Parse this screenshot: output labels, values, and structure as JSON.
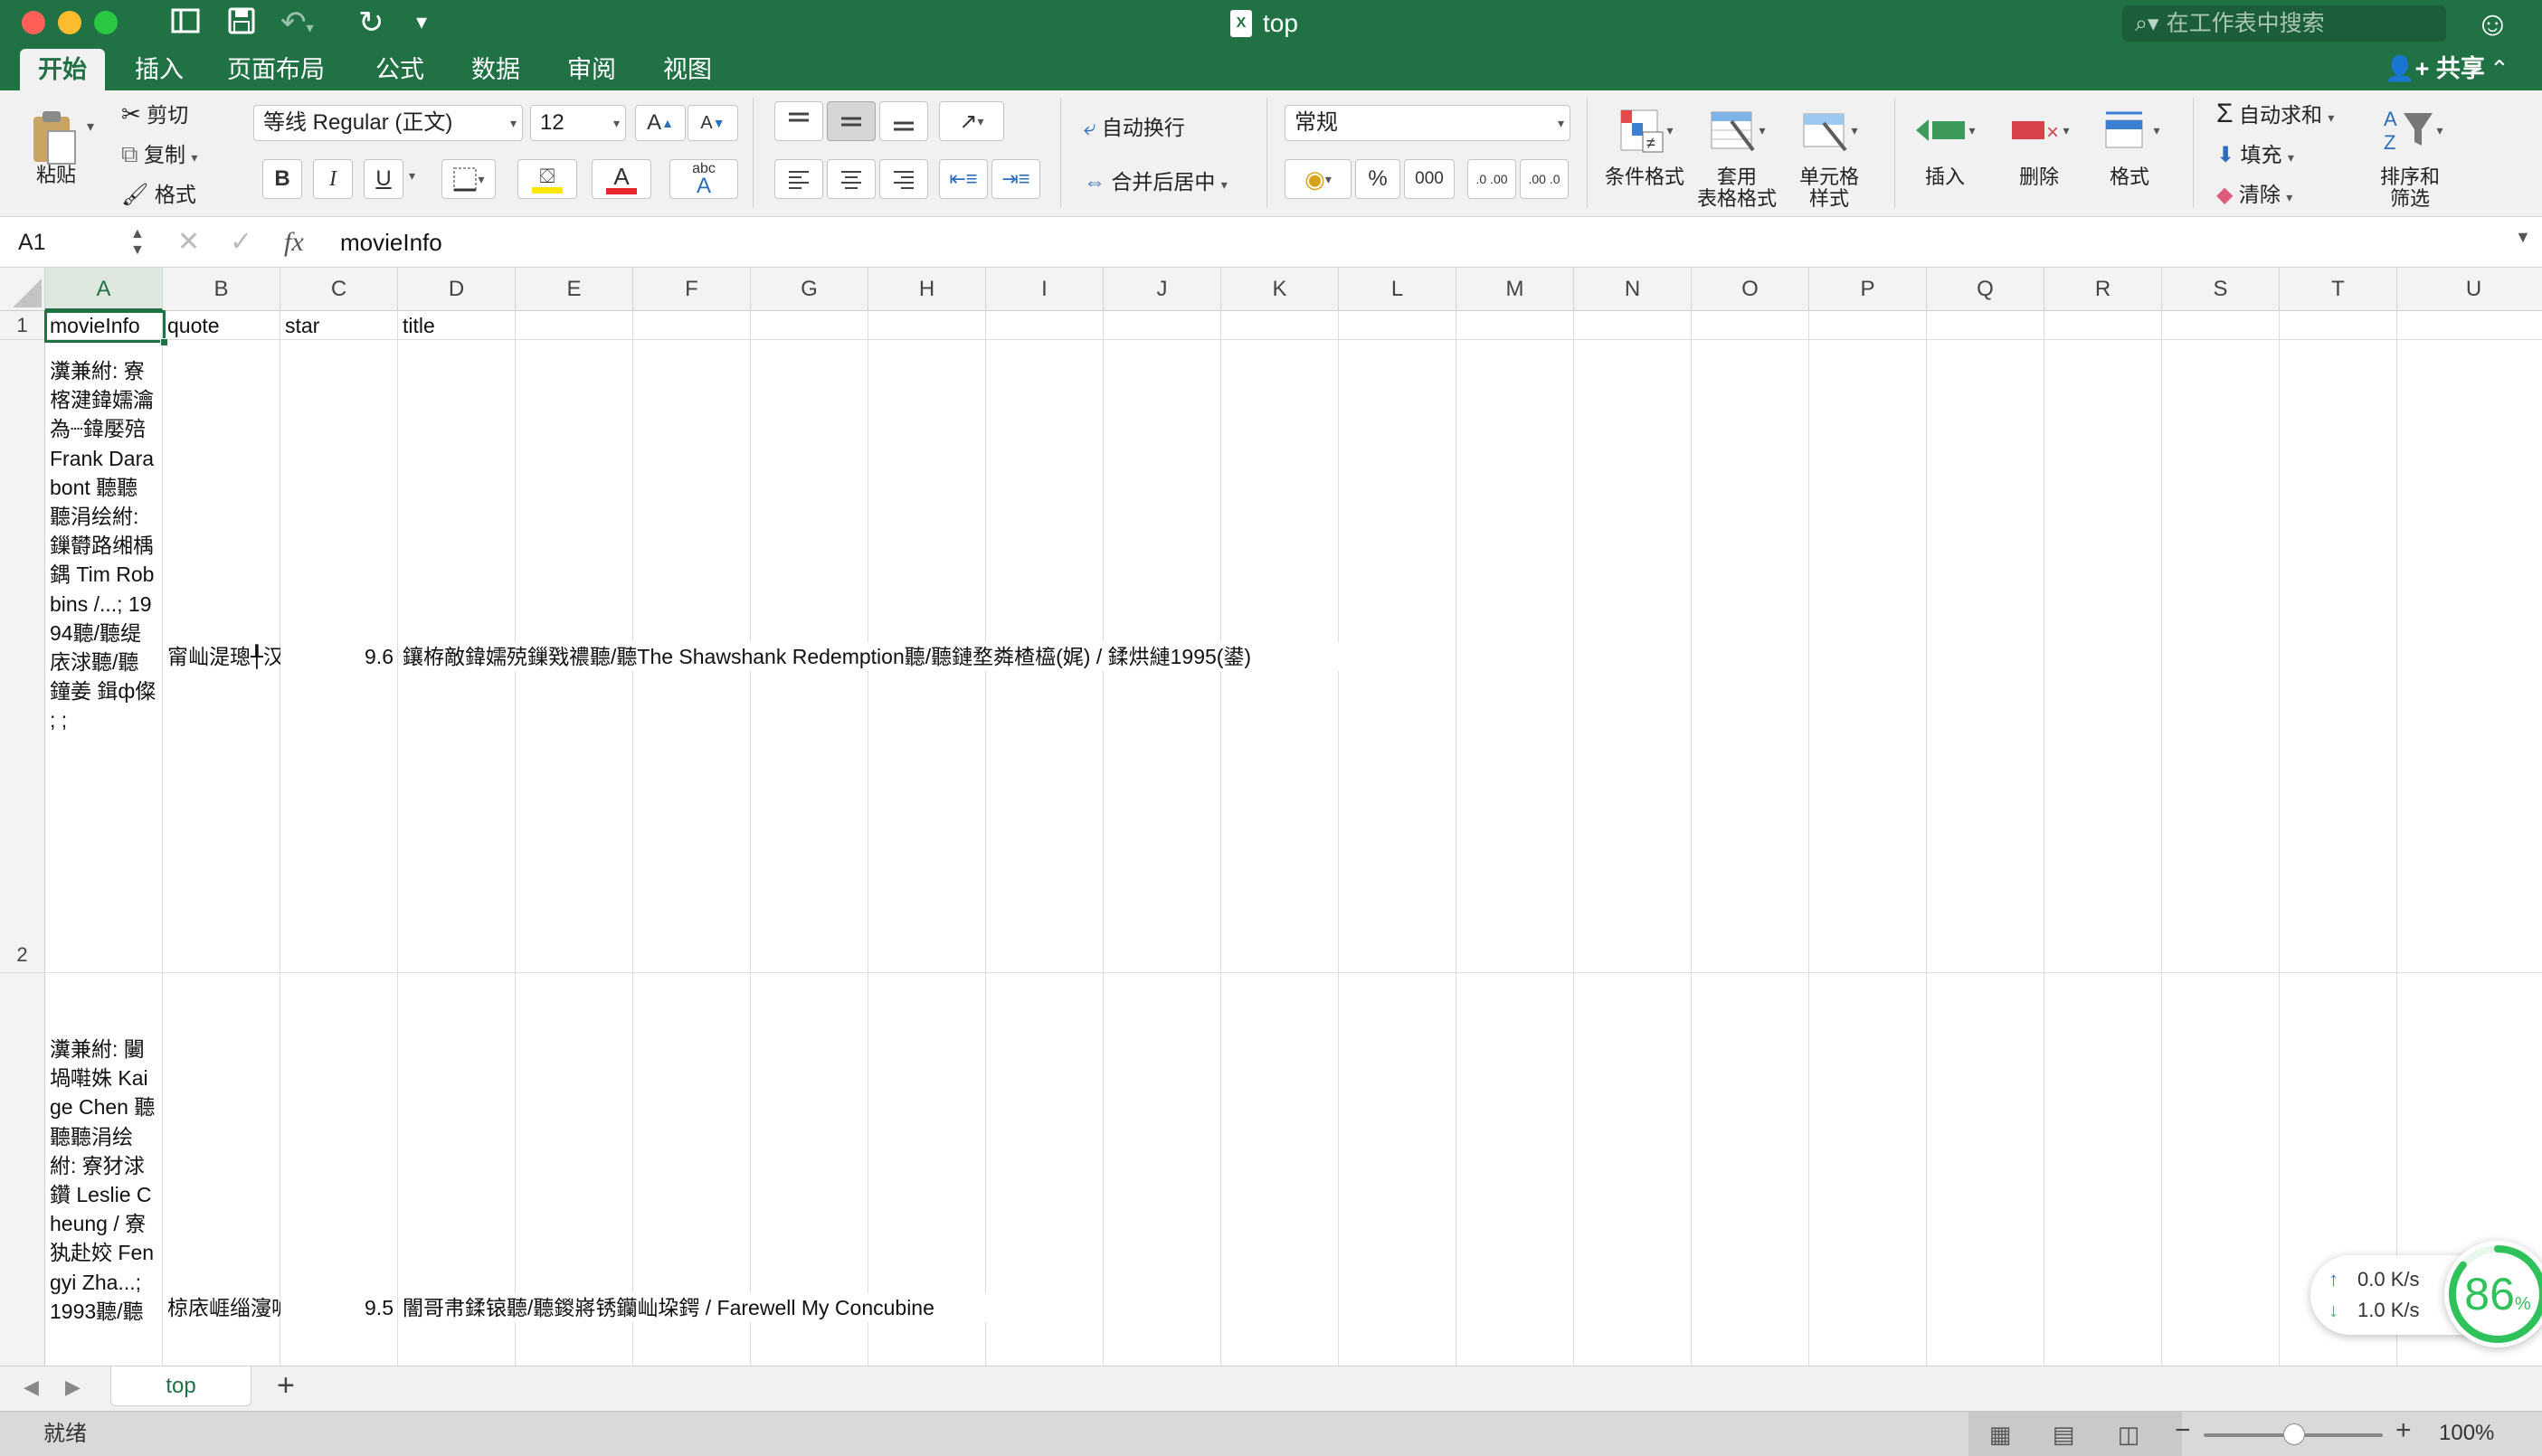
{
  "window": {
    "title": "top",
    "search_placeholder": "在工作表中搜索",
    "share_label": "共享",
    "ribbon_tabs": [
      "开始",
      "插入",
      "页面布局",
      "公式",
      "数据",
      "审阅",
      "视图"
    ]
  },
  "ribbon": {
    "paste": "粘贴",
    "cut": "剪切",
    "copy": "复制",
    "format_painter": "格式",
    "font_name": "等线 Regular (正文)",
    "font_size": "12",
    "bold": "B",
    "italic": "I",
    "underline": "U",
    "font_color_glyph": "A",
    "phonetic_glyph": "abc",
    "wrap_text": "自动换行",
    "merge_center": "合并后居中",
    "number_format": "常规",
    "percent": "%",
    "thousands": "000",
    "inc_decimal": ".0 .00",
    "dec_decimal": ".00 .0",
    "conditional_format": "条件格式",
    "table_format_line1": "套用",
    "table_format_line2": "表格格式",
    "cell_style_line1": "单元格",
    "cell_style_line2": "样式",
    "insert": "插入",
    "delete": "删除",
    "format": "格式",
    "autosum": "自动求和",
    "fill": "填充",
    "clear": "清除",
    "sort_filter_line1": "排序和",
    "sort_filter_line2": "筛选",
    "colors": {
      "green": "#207245",
      "font_red": "#e8262b",
      "highlight_yellow": "#ffe600"
    }
  },
  "formula_bar": {
    "name_box": "A1",
    "formula": "movieInfo",
    "fx": "fx"
  },
  "sheet": {
    "columns": [
      "A",
      "B",
      "C",
      "D",
      "E",
      "F",
      "G",
      "H",
      "I",
      "J",
      "K",
      "L",
      "M",
      "N",
      "O",
      "P",
      "Q",
      "R",
      "S",
      "T",
      "U"
    ],
    "row_numbers": [
      "1",
      "2"
    ],
    "header": {
      "A": "movieInfo",
      "B": "quote",
      "C": "star",
      "D": "title"
    },
    "row2": {
      "A": "瀵兼紨: 寮楁湕鍏嬬瀹為┈鍏嬮殕 Frank Darabont 聽聽聽涓绘紨: 鏁欎路缃楀鍝 Tim Robbins /...;  1994聽/聽缇庡浗聽/聽鐘姜 鍓ф儏 ;  ;",
      "B": "甯屾湜璁╀汉鑷敱",
      "C": "9.6",
      "D": "鑲栫敵鍏嬬殑鏁戣禯聽/聽The Shawshank Redemption聽/聽鏈堥粦楂橀(娓)  /  鍒烘縺1995(鍙)"
    },
    "row3": {
      "A": "瀵兼紨: 闄堝嚡姝 Kaige Chen 聽聽聽涓绘紨: 寮犲浗鑽 Leslie Cheung / 寮犱赴姣 Fengyi Zha...;  1993聽/聽",
      "B": "椋庡崕缁濅唬",
      "C": "9.5",
      "D": "闇哥帇鍒锿聽/聽鍐嶈锈钄屾垜鍔    /  Farewell My Concubine"
    }
  },
  "net_widget": {
    "upload": "0.0 K/s",
    "download": "1.0 K/s",
    "percent": "86",
    "percent_sign": "%"
  },
  "sheet_tabs": {
    "active": "top",
    "add": "+"
  },
  "status": {
    "text": "就绪",
    "zoom": "100%",
    "zoom_minus": "−",
    "zoom_plus": "+",
    "zoom_level": 1.0
  }
}
